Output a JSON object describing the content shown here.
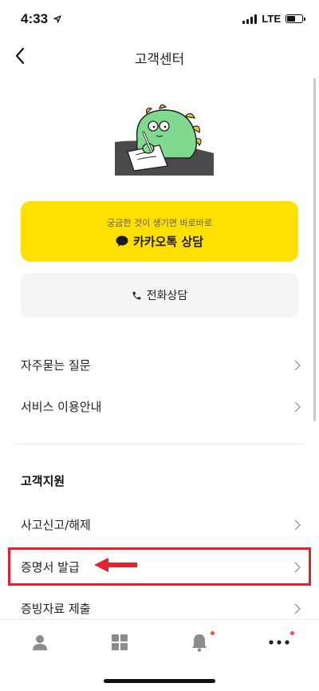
{
  "status_bar": {
    "time": "4:33",
    "network": "LTE",
    "battery_level": 0.55
  },
  "header": {
    "title": "고객센터"
  },
  "kakao_button": {
    "subtitle": "궁금한 것이 생기면 바로바로",
    "label": "카카오톡 상담",
    "color": "#FFE000"
  },
  "phone_button": {
    "label": "전화상담"
  },
  "menu": {
    "items": [
      {
        "label": "자주묻는 질문"
      },
      {
        "label": "서비스 이용안내"
      }
    ]
  },
  "support": {
    "title": "고객지원",
    "items": [
      {
        "label": "사고신고/해제"
      },
      {
        "label": "증명서 발급",
        "highlighted": true
      },
      {
        "label": "증빙자료 제출"
      }
    ]
  },
  "annotation": {
    "highlight_color": "#e3222b"
  },
  "tabbar": {
    "tabs": [
      {
        "icon": "person-icon"
      },
      {
        "icon": "grid-icon"
      },
      {
        "icon": "bell-icon",
        "badge": true
      },
      {
        "icon": "more-icon",
        "badge": true
      }
    ],
    "badge_color": "#ff4b4b"
  }
}
